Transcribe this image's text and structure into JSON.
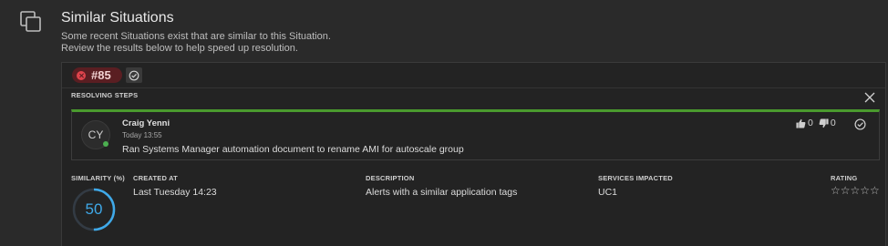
{
  "header": {
    "title": "Similar Situations",
    "subtitle_line1": "Some recent Situations exist that are similar to this Situation.",
    "subtitle_line2": "Review the results below to help speed up resolution."
  },
  "situation": {
    "id": "#85",
    "severity_color": "#e0444c",
    "resolving_steps_label": "RESOLVING STEPS",
    "step": {
      "author": "Craig Yenni",
      "initials": "CY",
      "time": "Today 13:55",
      "text": "Ran Systems Manager automation document to rename AMI for autoscale group",
      "upvotes": "0",
      "downvotes": "0",
      "accent_color": "#4a9a2e"
    },
    "stats": {
      "similarity_label": "SIMILARITY (%)",
      "similarity_value": "50",
      "similarity_fraction": 0.5,
      "created_label": "CREATED AT",
      "created_value": "Last Tuesday 14:23",
      "description_label": "DESCRIPTION",
      "description_value": "Alerts with a similar application tags",
      "services_label": "SERVICES IMPACTED",
      "services_value": "UC1",
      "rating_label": "RATING",
      "rating_value": 0,
      "rating_max": 5,
      "rating_stars": "☆☆☆☆☆"
    }
  },
  "icons": {
    "copy": "copy-icon",
    "severity": "severity-critical-icon",
    "resolve": "check-circle-icon",
    "close": "close-icon",
    "upvote": "thumbs-up-icon",
    "downvote": "thumbs-down-icon"
  },
  "colors": {
    "gauge": "#3fa9e8",
    "presence": "#4caf50"
  }
}
